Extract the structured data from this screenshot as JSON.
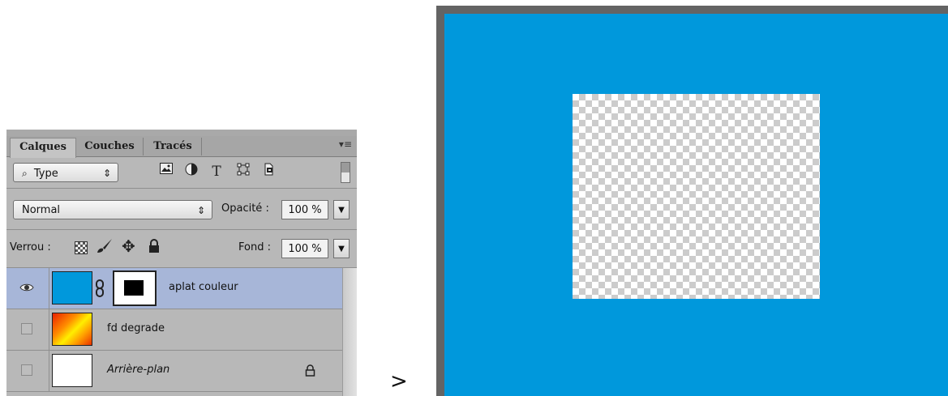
{
  "panel": {
    "tabs": [
      "Calques",
      "Couches",
      "Tracés"
    ],
    "active_tab": "Calques",
    "filter": {
      "label": "Type",
      "icons": [
        "image-filter-icon",
        "adjustment-filter-icon",
        "text-filter-icon",
        "shape-filter-icon",
        "smart-object-filter-icon"
      ]
    },
    "blend_mode": "Normal",
    "opacity_label": "Opacité :",
    "opacity_value": "100 %",
    "lock_label": "Verrou :",
    "fill_label": "Fond :",
    "fill_value": "100 %",
    "layers": [
      {
        "name": "aplat couleur",
        "selected": true,
        "visible": true,
        "thumb_color": "#0098dc",
        "has_mask": true
      },
      {
        "name": "fd degrade",
        "selected": false,
        "visible": false,
        "thumb": "gradient"
      },
      {
        "name": "Arrière-plan",
        "selected": false,
        "visible": false,
        "thumb_color": "#ffffff",
        "locked": true
      }
    ]
  },
  "separator": ">",
  "colors": {
    "canvas_fill": "#0098dc",
    "selected_layer": "#a7b6d8",
    "panel_bg": "#b8b8b8"
  }
}
